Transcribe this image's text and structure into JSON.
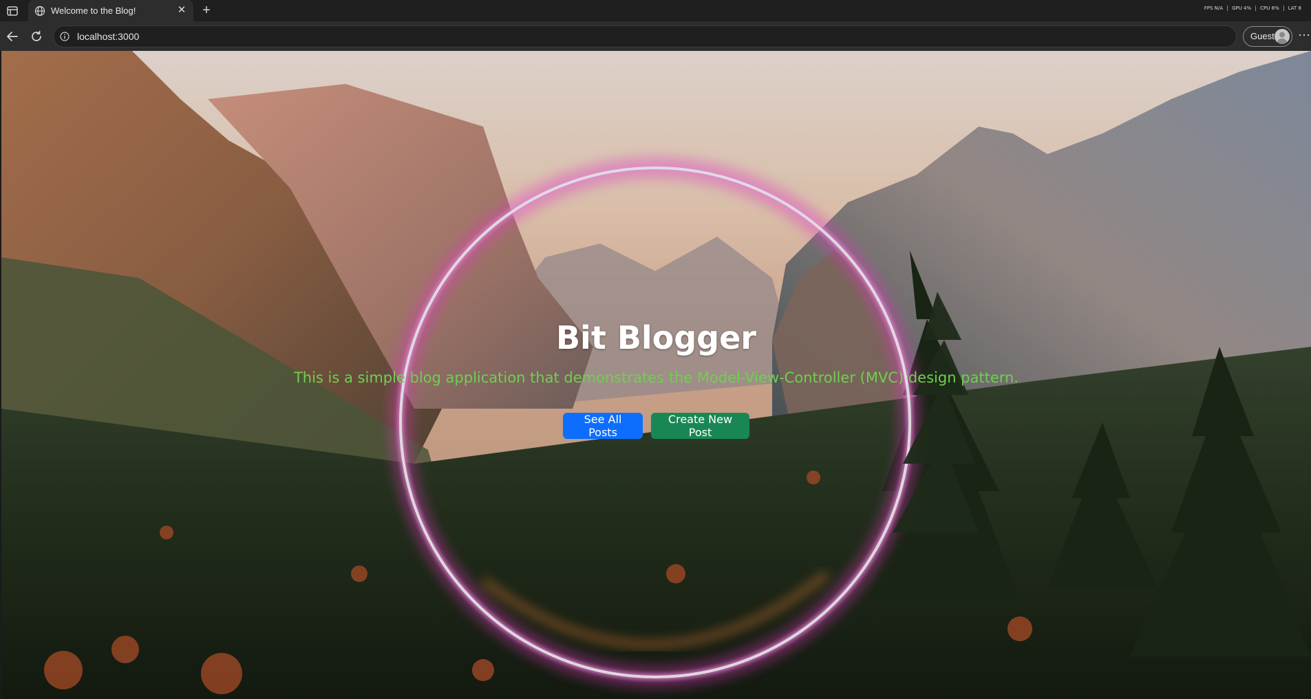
{
  "browser": {
    "tab_title": "Welcome to the Blog!",
    "url": "localhost:3000",
    "profile_label": "Guest",
    "sysinfo": [
      "FPS N/A",
      "GPU 4%",
      "CPU 8%",
      "LAT 8"
    ]
  },
  "hero": {
    "title": "Bit Blogger",
    "subtitle": "This is a simple blog application that demonstrates the Model-View-Controller (MVC) design pattern.",
    "see_all_label": "See All Posts",
    "create_label": "Create New Post"
  },
  "colors": {
    "primary": "#0d6efd",
    "success": "#198754",
    "subtitle": "#6fd04f"
  }
}
